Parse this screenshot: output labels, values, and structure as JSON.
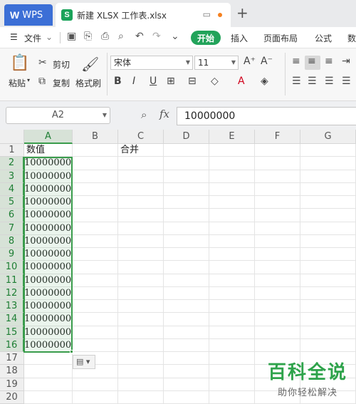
{
  "titlebar": {
    "wps_tab": "WPS",
    "doc_tab": "新建 XLSX 工作表.xlsx",
    "new_tab": "+"
  },
  "menubar": {
    "file": "文件",
    "start": "开始",
    "items": [
      "插入",
      "页面布局",
      "公式",
      "数"
    ]
  },
  "ribbon": {
    "paste": "粘贴",
    "cut": "剪切",
    "copy": "复制",
    "format_painter": "格式刷",
    "font_name": "宋体",
    "font_size": "11",
    "bold": "B",
    "italic": "I",
    "underline": "U"
  },
  "formula_bar": {
    "name_box": "A2",
    "fx": "fx",
    "value": "10000000"
  },
  "sheet": {
    "columns": [
      "A",
      "B",
      "C",
      "D",
      "E",
      "F",
      "G"
    ],
    "rows": [
      "1",
      "2",
      "3",
      "4",
      "5",
      "6",
      "7",
      "8",
      "9",
      "10",
      "11",
      "12",
      "13",
      "14",
      "15",
      "16",
      "17",
      "18",
      "19",
      "20"
    ],
    "a1": "数值",
    "c1": "合并",
    "a_values": [
      "10000000",
      "10000000",
      "10000000",
      "10000000",
      "10000000",
      "10000000",
      "10000000",
      "10000000",
      "10000000",
      "10000000",
      "10000000",
      "10000000",
      "10000000",
      "10000000",
      "10000000"
    ]
  },
  "watermark": {
    "main": "百科全说",
    "sub": "助你轻松解决"
  }
}
